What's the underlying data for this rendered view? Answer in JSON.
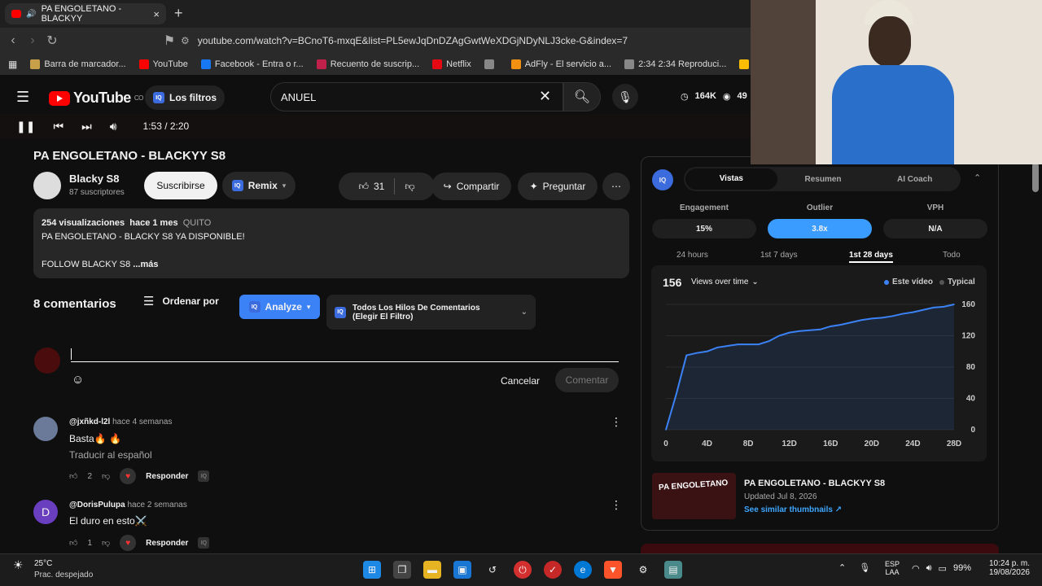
{
  "browser": {
    "tab_title": "PA ENGOLETANO - BLACKYY",
    "url": "youtube.com/watch?v=BCnoT6-mxqE&list=PL5ewJqDnDZAgGwtWeXDGjNDyNLJ3cke-G&index=7",
    "bookmarks": [
      {
        "label": "Barra de marcador...",
        "color": "#c8a04a"
      },
      {
        "label": "YouTube",
        "color": "#ff0000"
      },
      {
        "label": "Facebook - Entra o r...",
        "color": "#1877f2"
      },
      {
        "label": "Recuento de suscrip...",
        "color": "#c0214a"
      },
      {
        "label": "Netflix",
        "color": "#e50914"
      },
      {
        "label": "",
        "color": "#888888"
      },
      {
        "label": "AdFly - El servicio a...",
        "color": "#f29111"
      },
      {
        "label": "2:34 2:34 Reproduci...",
        "color": "#888888"
      },
      {
        "label": "Google AdSe",
        "color": "#fbbc04"
      }
    ]
  },
  "header": {
    "region": "CO",
    "logo_text": "YouTube",
    "filter_label": "Los filtros",
    "search_value": "ANUEL",
    "stat_views": "164K",
    "stat_watch": "49"
  },
  "player": {
    "time": "1:53 / 2:20"
  },
  "video": {
    "title": "PA ENGOLETANO - BLACKYY S8",
    "channel": "Blacky S8",
    "subscribers": "87 suscriptores",
    "subscribe_label": "Suscribirse",
    "remix_label": "Remix",
    "likes": "31",
    "share_label": "Compartir",
    "ask_label": "Preguntar",
    "desc_views": "254 visualizaciones",
    "desc_date": "hace 1 mes",
    "desc_tag": "QUITO",
    "desc_line1": "PA ENGOLETANO - BLACKY S8 YA DISPONIBLE!",
    "desc_line2": "FOLLOW BLACKY S8",
    "desc_more": "...más"
  },
  "comments": {
    "count_label": "8 comentarios",
    "sort_label": "Ordenar por",
    "analyze_label": "Analyze",
    "threads_label": "Todos Los Hilos De Comentarios (Elegir El Filtro)",
    "cancel_label": "Cancelar",
    "submit_label": "Comentar",
    "reply_label": "Responder",
    "items": [
      {
        "user": "@jxñkd-l2l",
        "time": "hace 4 semanas",
        "text": "Basta🔥 🔥",
        "translate": "Traducir al español",
        "likes": "2",
        "avatar_color": "#6b7a99"
      },
      {
        "user": "@DorisPulupa",
        "time": "hace 2 semanas",
        "text": "El duro en esto⚔️",
        "translate": "",
        "likes": "1",
        "avatar_color": "#6a3fbf",
        "initial": "D"
      }
    ]
  },
  "panel": {
    "tabs": [
      "Vistas",
      "Resumen",
      "AI Coach"
    ],
    "metrics": [
      {
        "label": "Engagement",
        "value": "15%"
      },
      {
        "label": "Outlier",
        "value": "3.8x"
      },
      {
        "label": "VPH",
        "value": "N/A"
      }
    ],
    "ranges": [
      "24 hours",
      "1st 7 days",
      "1st 28 days",
      "Todo"
    ],
    "active_range": "1st 28 days",
    "total": "156",
    "dropdown": "Views over time",
    "legend_this": "Este vídeo",
    "legend_typical": "Typical",
    "related_title": "PA ENGOLETANO - BLACKYY S8",
    "related_updated": "Updated Jul 8, 2026",
    "related_link": "See similar thumbnails",
    "thumb_text": "PA ENGOLETANO"
  },
  "chart_data": {
    "type": "area",
    "x": [
      0,
      1,
      2,
      3,
      4,
      5,
      6,
      7,
      8,
      9,
      10,
      11,
      12,
      13,
      14,
      15,
      16,
      17,
      18,
      19,
      20,
      21,
      22,
      23,
      24,
      25,
      26,
      27,
      28
    ],
    "values": [
      0,
      45,
      95,
      98,
      100,
      105,
      107,
      109,
      109,
      109,
      113,
      120,
      124,
      126,
      127,
      128,
      132,
      134,
      137,
      140,
      142,
      143,
      145,
      148,
      150,
      153,
      156,
      157,
      160
    ],
    "xticks": [
      "0",
      "4D",
      "8D",
      "12D",
      "16D",
      "20D",
      "24D",
      "28D"
    ],
    "yticks": [
      "0",
      "40",
      "80",
      "120",
      "160"
    ],
    "ylim": [
      0,
      160
    ],
    "xlim": [
      0,
      28
    ],
    "color": "#3b82f6"
  },
  "taskbar": {
    "temp": "25°C",
    "weather": "Prac. despejado",
    "lang1": "ESP",
    "lang2": "LAA",
    "battery": "99%",
    "time": "10:24 p. m.",
    "date": "19/08/2026"
  }
}
